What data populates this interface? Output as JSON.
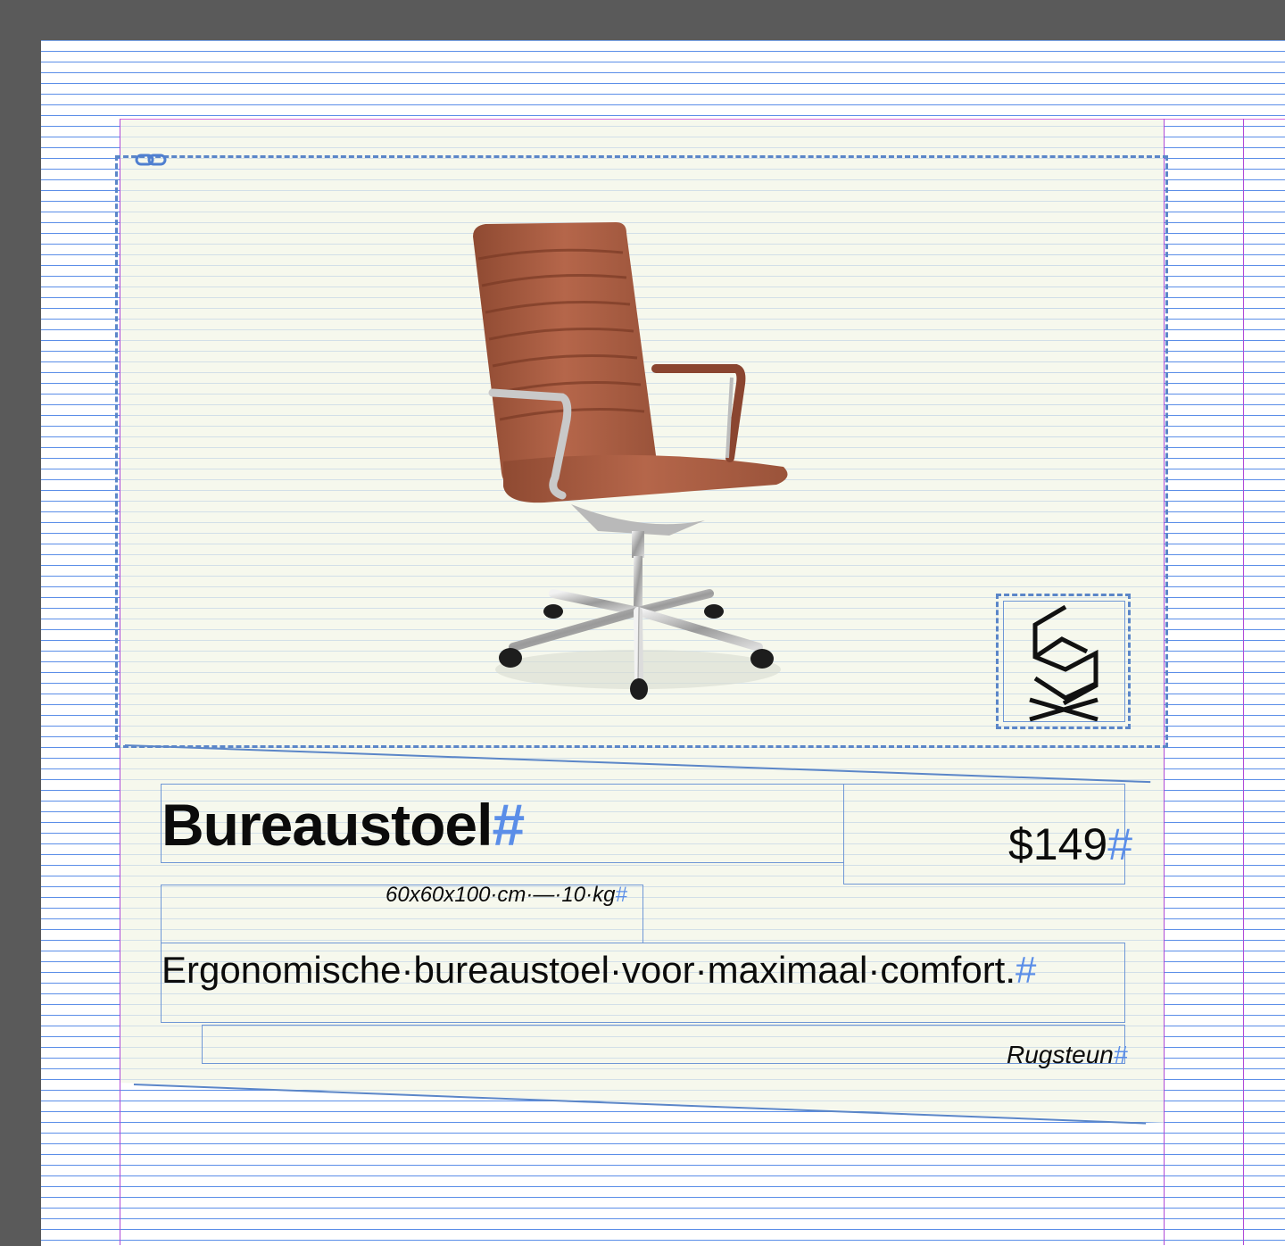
{
  "product": {
    "title": "Bureaustoel",
    "price": "$149",
    "dimensions": "60x60x100·cm·—·10·kg",
    "description": "Ergonomische·bureaustoel·voor·maximaal·comfort.",
    "tag": "Rugsteun",
    "paragraph_mark": "#"
  },
  "image": {
    "subject": "office chair",
    "icon": "chair-image"
  },
  "logo": {
    "icon": "brand-logo-icon"
  },
  "link_badge": {
    "icon": "link-icon"
  },
  "colors": {
    "pasteboard": "#5a5a5a",
    "baseline_grid": "#5b8ee8",
    "margin_guides": "#b04bd8",
    "frame_dashes": "#5b86c8",
    "card_fill": "#f4f6e8"
  }
}
